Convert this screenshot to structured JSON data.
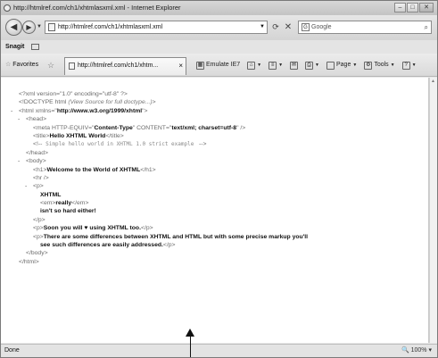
{
  "window": {
    "title": "http://htmlref.com/ch1/xhtmlasxml.xml - Internet Explorer",
    "buttons": {
      "minimize": "–",
      "maximize": "□",
      "close": "✕"
    }
  },
  "address": {
    "url": "http://htmlref.com/ch1/xhtmlasxml.xml",
    "search_placeholder": "Google"
  },
  "snagit": {
    "label": "Snagit"
  },
  "favorites": {
    "label": "Favorites"
  },
  "tab": {
    "label": "http://htmlref.com/ch1/xhtm..."
  },
  "toolbar": {
    "emulate_label": "Emulate IE7",
    "page_label": "Page",
    "tools_label": "Tools"
  },
  "xml_source": {
    "line1": "<?xml version=\"1.0\" encoding=\"utf-8\" ?>",
    "line2_a": "<!DOCTYPE html",
    "line2_b": "(View Source for full doctype...)",
    "line2_c": ">",
    "line3_a": "<html xmlns=\"",
    "line3_b": "http://www.w3.org/1999/xhtml",
    "line3_c": "\">",
    "head_open": "<head>",
    "meta_a": "<meta HTTP-EQUIV=\"",
    "meta_b": "Content-Type",
    "meta_c": "\" CONTENT=\"",
    "meta_d": "text/xml; charset=utf-8",
    "meta_e": "\" />",
    "title_open": "<title>",
    "title_text": "Hello XHTML World",
    "title_close": "</title>",
    "comment_open": "<!--",
    "comment_text": "Simple hello world in XHTML 1.0 strict example",
    "comment_close": "-->",
    "head_close": "</head>",
    "body_open": "<body>",
    "h1_open": "<h1>",
    "h1_text": "Welcome to the World of XHTML",
    "h1_close": "</h1>",
    "hr": "<hr />",
    "p_open": "<p>",
    "p1_text1": "XHTML",
    "em_open": "<em>",
    "em_text": "really",
    "em_close": "</em>",
    "p1_text2": "isn't so hard either!",
    "p_close": "</p>",
    "p2_text": "Soon you will ♥ using XHTML too.",
    "p3_text_line1": "There are some differences between XHTML and HTML but with some precise markup you'll",
    "p3_text_line2": "see such differences are easily addressed.",
    "body_close": "</body>",
    "html_close": "</html>"
  },
  "status": {
    "left": "Done",
    "zoom": "100%"
  }
}
